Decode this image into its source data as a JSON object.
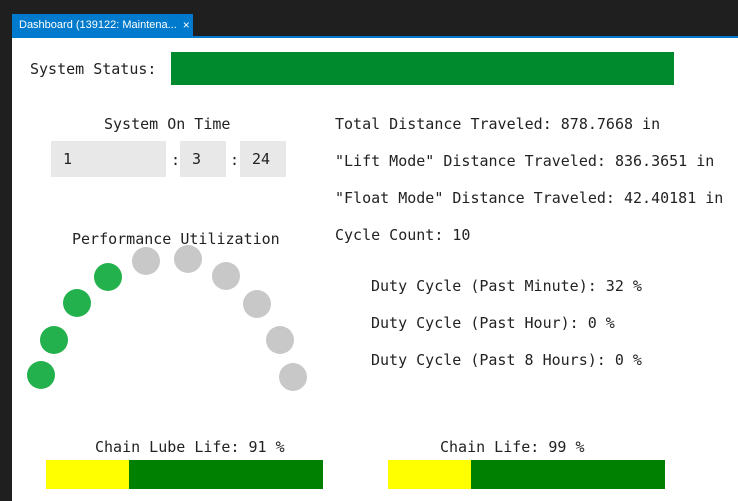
{
  "tab": {
    "title": "Dashboard (139122: Maintena...",
    "close_glyph": "×"
  },
  "system_status": {
    "label": "System Status:",
    "color": "#008a2e"
  },
  "system_on_time": {
    "label": "System On Time",
    "hours": "1",
    "minutes": "3",
    "seconds": "24",
    "separator": ":"
  },
  "stats": {
    "total_distance": "Total Distance Traveled: 878.7668 in",
    "lift_distance": "\"Lift Mode\" Distance Traveled: 836.3651 in",
    "float_distance": "\"Float Mode\" Distance Traveled: 42.40181 in",
    "cycle_count": "Cycle Count: 10"
  },
  "duty_cycle": {
    "past_minute": "Duty Cycle (Past Minute): 32 %",
    "past_hour": "Duty Cycle (Past Hour): 0 %",
    "past_8_hours": "Duty Cycle (Past 8 Hours): 0 %"
  },
  "performance": {
    "label": "Performance Utilization",
    "active_count": 4,
    "total_count": 10,
    "active_color": "#22b14c",
    "inactive_color": "#c8c8c8"
  },
  "chain_lube_life": {
    "label": "Chain Lube Life: 91 %",
    "percent": 91,
    "warn_color": "#ffff00",
    "ok_color": "#008000"
  },
  "chain_life": {
    "label": "Chain Life: 99 %",
    "percent": 99,
    "warn_color": "#ffff00",
    "ok_color": "#008000"
  }
}
